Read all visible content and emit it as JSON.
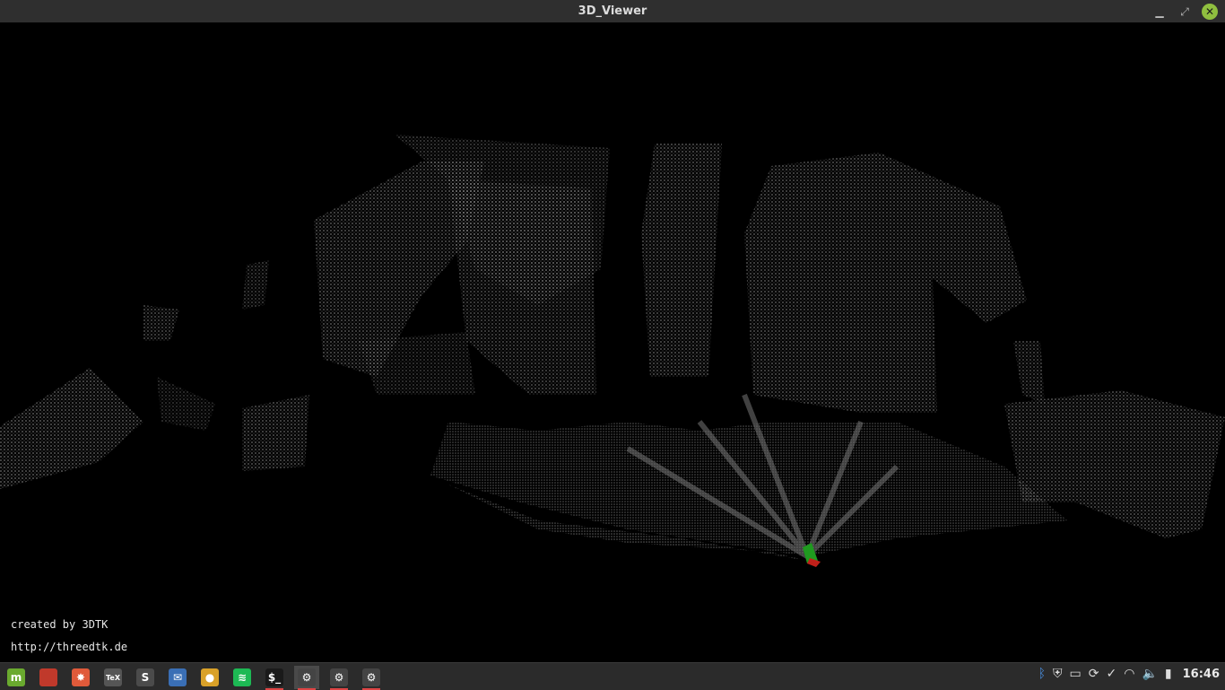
{
  "window": {
    "title": "3D_Viewer",
    "minimize_icon": "minimize-icon",
    "restore_icon": "restore-icon",
    "close_icon": "close-icon"
  },
  "viewport": {
    "credit_line1": "created by 3DTK",
    "credit_line2": "http://threedtk.de"
  },
  "taskbar": {
    "launchers": [
      {
        "name": "mint-menu-icon",
        "glyph": "m",
        "color": "#6aaa2f"
      },
      {
        "name": "files-icon",
        "glyph": "",
        "color": "#c0392b"
      },
      {
        "name": "screenshot-icon",
        "glyph": "✸",
        "color": "#e05a3a"
      },
      {
        "name": "tex-icon",
        "glyph": "TeX",
        "color": "#555"
      },
      {
        "name": "sublime-icon",
        "glyph": "S",
        "color": "#4b4b4b"
      },
      {
        "name": "mail-icon",
        "glyph": "✉",
        "color": "#3a6fb5"
      },
      {
        "name": "chrome-icon",
        "glyph": "●",
        "color": "#d9a128"
      },
      {
        "name": "spotify-icon",
        "glyph": "≋",
        "color": "#1db954"
      },
      {
        "name": "terminal-icon",
        "glyph": "$_",
        "color": "#1a1a1a"
      },
      {
        "name": "settings-app-icon-1",
        "glyph": "⚙",
        "color": "#444"
      },
      {
        "name": "settings-app-icon-2",
        "glyph": "⚙",
        "color": "#444"
      },
      {
        "name": "settings-app-icon-3",
        "glyph": "⚙",
        "color": "#444"
      }
    ],
    "tray": {
      "bluetooth_icon": "ᛒ",
      "shield_icon": "⛨",
      "display_icon": "▭",
      "sync_icon": "⟳",
      "check_icon": "✓",
      "wifi_icon": "◠",
      "volume_icon": "🔈",
      "battery_icon": "▮",
      "clock": "16:46"
    }
  }
}
